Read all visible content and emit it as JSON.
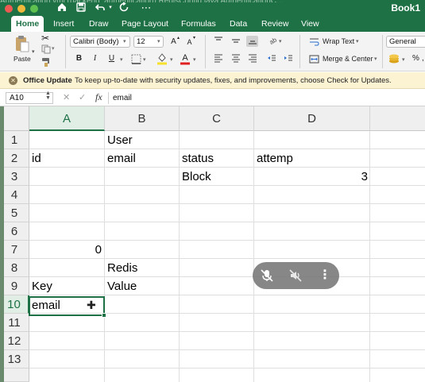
{
  "window": {
    "title": "Book1",
    "background_tabs_text": "Authentication.yml   (backend_authentication)   RedisConfig.java   AuthenticationC..."
  },
  "ribbon_tabs": [
    "Home",
    "Insert",
    "Draw",
    "Page Layout",
    "Formulas",
    "Data",
    "Review",
    "View"
  ],
  "ribbon": {
    "paste_label": "Paste",
    "font_name": "Calibri (Body)",
    "font_size": "12",
    "grow_font": "A",
    "shrink_font": "A",
    "bold": "B",
    "italic": "I",
    "underline": "U",
    "wrap_text_label": "Wrap Text",
    "merge_center_label": "Merge & Center",
    "number_format": "General",
    "percent": "%",
    "comma": ","
  },
  "message_bar": {
    "title": "Office Update",
    "text": "To keep up-to-date with security updates, fixes, and improvements, choose Check for Updates."
  },
  "formula_bar": {
    "name_box": "A10",
    "fx": "fx",
    "value": "email"
  },
  "grid": {
    "columns": [
      "A",
      "B",
      "C",
      "D"
    ],
    "selected_column": "A",
    "rows": [
      "1",
      "2",
      "3",
      "4",
      "5",
      "6",
      "7",
      "8",
      "9",
      "10",
      "11",
      "12",
      "13"
    ],
    "selected_row": "10",
    "cells": {
      "B1": "User",
      "A2": "id",
      "B2": "email",
      "C2": "status",
      "D2": "attemp",
      "C3": "Block",
      "D3": "3",
      "A7": "0",
      "B8": "Redis",
      "A9": "Key",
      "B9": "Value",
      "A10": "email"
    },
    "active_cell": "A10"
  },
  "colors": {
    "excel_green": "#1e7145",
    "message_bar_bg": "#fcf3d3",
    "header_bg": "#efefef"
  },
  "floating_toolbar": {
    "icons": [
      "mic-off-icon",
      "speaker-off-icon",
      "more-vertical-icon"
    ]
  }
}
